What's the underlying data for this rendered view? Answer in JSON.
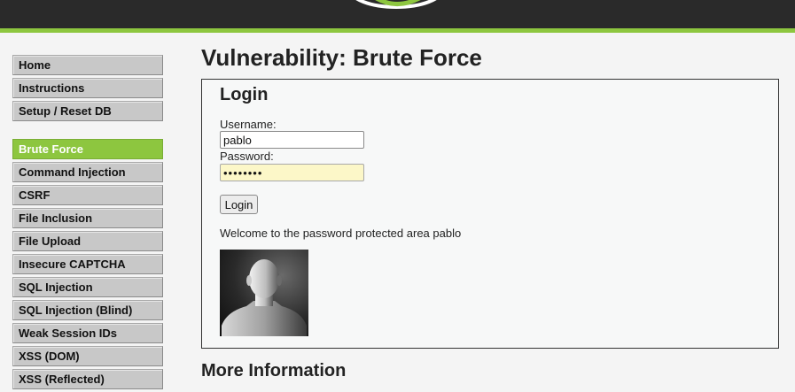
{
  "page": {
    "title": "Vulnerability: Brute Force"
  },
  "sidebar": {
    "group1": [
      {
        "label": "Home"
      },
      {
        "label": "Instructions"
      },
      {
        "label": "Setup / Reset DB"
      }
    ],
    "group2": [
      {
        "label": "Brute Force",
        "selected": true
      },
      {
        "label": "Command Injection"
      },
      {
        "label": "CSRF"
      },
      {
        "label": "File Inclusion"
      },
      {
        "label": "File Upload"
      },
      {
        "label": "Insecure CAPTCHA"
      },
      {
        "label": "SQL Injection"
      },
      {
        "label": "SQL Injection (Blind)"
      },
      {
        "label": "Weak Session IDs"
      },
      {
        "label": "XSS (DOM)"
      },
      {
        "label": "XSS (Reflected)"
      }
    ]
  },
  "login": {
    "heading": "Login",
    "username_label": "Username:",
    "username_value": "pablo",
    "password_label": "Password:",
    "password_value": "letmein1",
    "button_label": "Login",
    "welcome": "Welcome to the password protected area pablo"
  },
  "more_info": {
    "heading": "More Information"
  },
  "colors": {
    "accent": "#8dc63f",
    "header": "#2a2a2a",
    "background": "#f4f4f4"
  }
}
